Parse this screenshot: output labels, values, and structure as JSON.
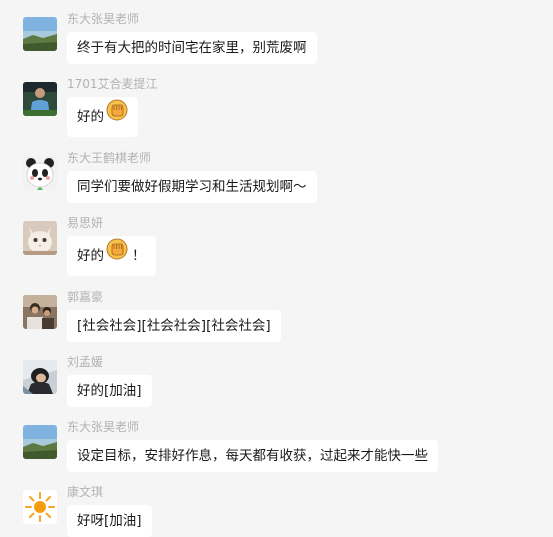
{
  "messages": [
    {
      "sender": "东大张昊老师",
      "text": "终于有大把的时间宅在家里，别荒废啊",
      "emoji": "",
      "suffix": ""
    },
    {
      "sender": "1701艾合麦提江",
      "text": "好的",
      "emoji": "fist-emoji",
      "suffix": ""
    },
    {
      "sender": "东大王鹤棋老师",
      "text": "同学们要做好假期学习和生活规划啊～",
      "emoji": "",
      "suffix": ""
    },
    {
      "sender": "易思妍",
      "text": "好的",
      "emoji": "fist-emoji",
      "suffix": "！"
    },
    {
      "sender": "郭嘉豪",
      "text": "[社会社会][社会社会][社会社会]",
      "emoji": "",
      "suffix": ""
    },
    {
      "sender": "刘孟媛",
      "text": "好的[加油]",
      "emoji": "",
      "suffix": ""
    },
    {
      "sender": "东大张昊老师",
      "text": "设定目标，安排好作息，每天都有收获，过起来才能快一些",
      "emoji": "",
      "suffix": ""
    },
    {
      "sender": "康文琪",
      "text": "好呀[加油]",
      "emoji": "",
      "suffix": ""
    }
  ],
  "colors": {
    "background": "#f5f5f5",
    "bubble": "#ffffff",
    "sender": "#b2b2b2",
    "text": "#1a1a1a"
  }
}
